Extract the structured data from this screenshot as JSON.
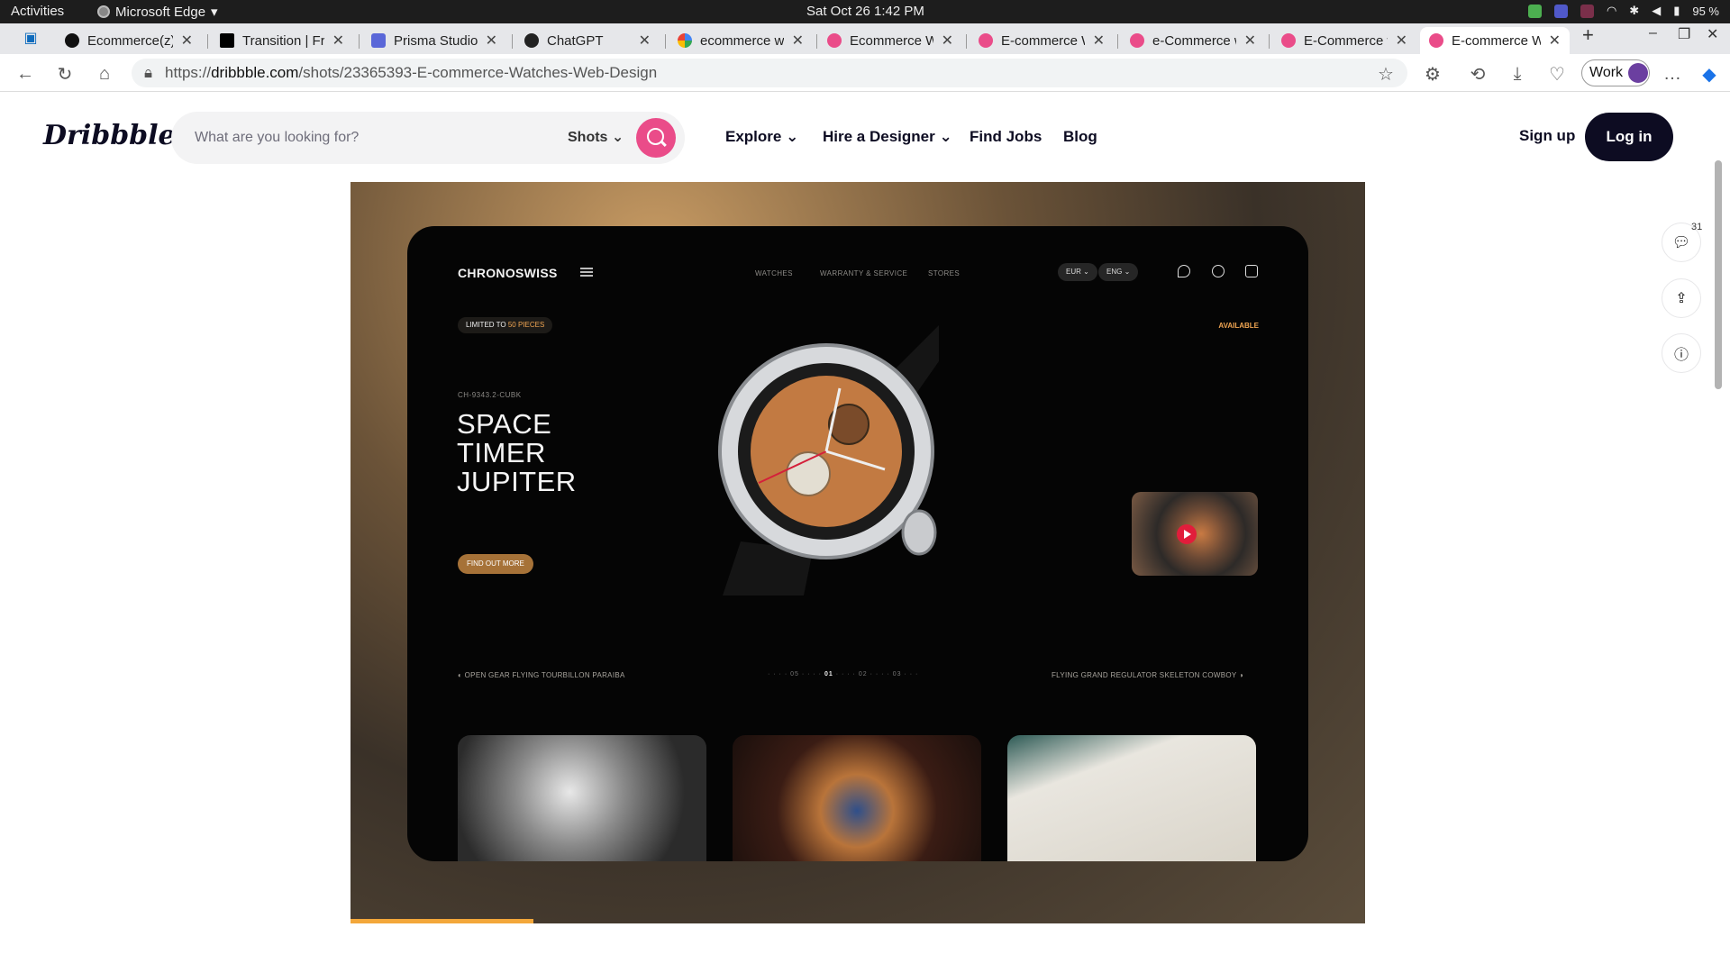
{
  "system_bar": {
    "activities": "Activities",
    "app_name": "Microsoft Edge",
    "clock": "Sat Oct 26  1:42 PM",
    "battery": "95 %"
  },
  "tabs": [
    {
      "label": "Ecommerce(z)",
      "active": false
    },
    {
      "label": "Transition | Fran",
      "active": false
    },
    {
      "label": "Prisma Studio",
      "active": false
    },
    {
      "label": "ChatGPT",
      "active": false
    },
    {
      "label": "ecommerce we",
      "active": false
    },
    {
      "label": "Ecommerce We",
      "active": false
    },
    {
      "label": "E-commerce We",
      "active": false
    },
    {
      "label": "e-Commerce we",
      "active": false
    },
    {
      "label": "E-Commerce we",
      "active": false
    },
    {
      "label": "E-commerce W",
      "active": true
    }
  ],
  "address_bar": {
    "url_prefix": "https://",
    "url_host": "dribbble.com",
    "url_path": "/shots/23365393-E-commerce-Watches-Web-Design",
    "profile_label": "Work"
  },
  "site_header": {
    "logo": "Dribbble",
    "search_placeholder": "What are you looking for?",
    "search_scope": "Shots",
    "nav": [
      "Explore",
      "Hire a Designer",
      "Find Jobs",
      "Blog"
    ],
    "signup": "Sign up",
    "login": "Log in"
  },
  "shot": {
    "brand": "CHRONOSWISS",
    "nav": [
      "WATCHES",
      "WARRANTY & SERVICE",
      "STORES"
    ],
    "currency": "EUR",
    "language": "ENG",
    "limited_prefix": "LIMITED TO",
    "limited_count": "50 PIECES",
    "availability": "AVAILABLE",
    "reference": "CH-9343.2-CUBK",
    "title_lines": [
      "SPACE",
      "TIMER",
      "JUPITER"
    ],
    "cta": "FIND OUT MORE",
    "prev_model": "OPEN GEAR FLYING TOURBILLON PARAIBA",
    "next_model": "FLYING GRAND REGULATOR SKELETON COWBOY",
    "pager": {
      "before": "05",
      "current": "01",
      "after": "02",
      "last": "03"
    },
    "progress_fraction": 0.18
  },
  "side_actions": {
    "comment_count": "31"
  },
  "colors": {
    "dribbble_pink": "#ea4c89",
    "dark_navy": "#0d0c22",
    "accent_orange": "#f0a552",
    "cta_bronze": "#a67238"
  }
}
